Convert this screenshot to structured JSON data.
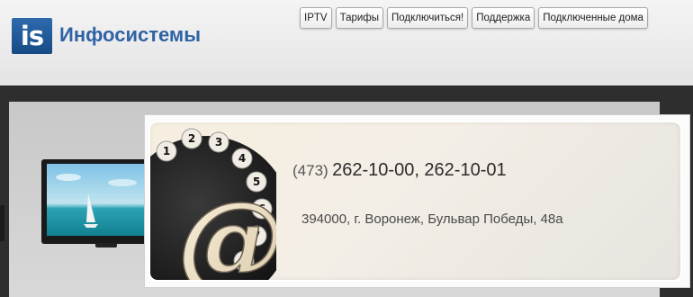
{
  "brand": {
    "logo_mark": "is",
    "name": "Инфосистемы",
    "color": "#2f63a6"
  },
  "nav": {
    "items": [
      {
        "label": "IPTV"
      },
      {
        "label": "Тарифы"
      },
      {
        "label": "Подключиться!"
      },
      {
        "label": "Поддержка"
      },
      {
        "label": "Подключенные дома"
      }
    ]
  },
  "contact": {
    "phone_code": "(473)",
    "phone_numbers": "262-10-00, 262-10-01",
    "address": "394000, г. Воронеж, Бульвар Победы, 48а"
  },
  "icons": {
    "tv": "tv-icon",
    "phone_at": "rotary-phone-at-icon"
  }
}
